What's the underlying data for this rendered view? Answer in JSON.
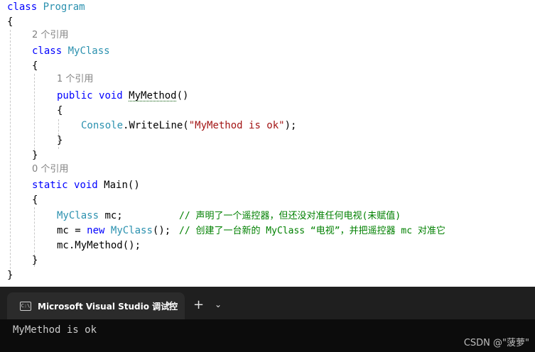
{
  "code": {
    "class_kw": "class",
    "program": "Program",
    "lbrace": "{",
    "rbrace": "}",
    "refs_myclass": "2 个引用",
    "myclass": "MyClass",
    "refs_mymethod": "1 个引用",
    "public": "public",
    "void": "void",
    "mymethod": "MyMethod",
    "parens": "()",
    "console": "Console",
    "writeline_call": ".WriteLine(",
    "string_literal": "\"MyMethod is ok\"",
    "close_call": ");",
    "refs_main": "0 个引用",
    "static": "static",
    "main": "Main",
    "mc_decl_var": " mc;",
    "comment1": "// 声明了一个遥控器，但还没对准任何电视(未赋值)",
    "mc_assign": "mc = ",
    "new": "new",
    "ctor_end": "(); ",
    "comment2": "// 创建了一台新的 MyClass “电视”，并把遥控器 mc 对准它",
    "mc_dot": "mc.",
    "call_end": "();"
  },
  "terminal": {
    "tab_title": "Microsoft Visual Studio 调试控",
    "tab_icon": "C:\\",
    "close_glyph": "✕",
    "plus_glyph": "+",
    "chevron_glyph": "⌄",
    "output": "MyMethod is ok",
    "watermark": "CSDN @\"菠萝\""
  },
  "icons": [
    "terminal-icon",
    "close-icon",
    "plus-icon",
    "chevron-down-icon"
  ]
}
